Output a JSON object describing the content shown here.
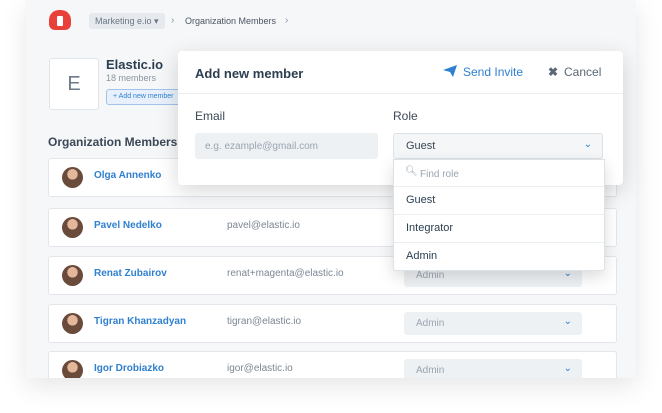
{
  "breadcrumb": {
    "logo_icon": "cloud-plug-logo",
    "org": "Marketing e.io",
    "org_caret": "▾",
    "sep1": "›",
    "current": "Organization Members",
    "sep2": "›"
  },
  "org": {
    "initial": "E",
    "name": "Elastic.io",
    "members_count": "18 members",
    "add_member_button": "+ Add new member"
  },
  "section_title": "Organization Members",
  "members": [
    {
      "name": "Olga Annenko",
      "email": "",
      "role": ""
    },
    {
      "name": "Pavel Nedelko",
      "email": "pavel@elastic.io",
      "role": ""
    },
    {
      "name": "Renat Zubairov",
      "email": "renat+magenta@elastic.io",
      "role": "Admin"
    },
    {
      "name": "Tigran Khanzadyan",
      "email": "tigran@elastic.io",
      "role": "Admin"
    },
    {
      "name": "Igor Drobiazko",
      "email": "igor@elastic.io",
      "role": "Admin"
    }
  ],
  "modal": {
    "title": "Add new member",
    "send_invite": "Send Invite",
    "send_icon": "paper-plane-icon",
    "cancel": "Cancel",
    "cancel_icon": "close-icon",
    "email_label": "Email",
    "email_placeholder": "e.g. ezample@gmail.com",
    "email_value": "",
    "role_label": "Role",
    "role_value": "Guest"
  },
  "dropdown": {
    "search_placeholder": "Find role",
    "options": [
      "Guest",
      "Integrator",
      "Admin"
    ]
  },
  "colors": {
    "accent": "#2f80d0",
    "logo": "#e8413c",
    "background": "#f5f7f9"
  }
}
